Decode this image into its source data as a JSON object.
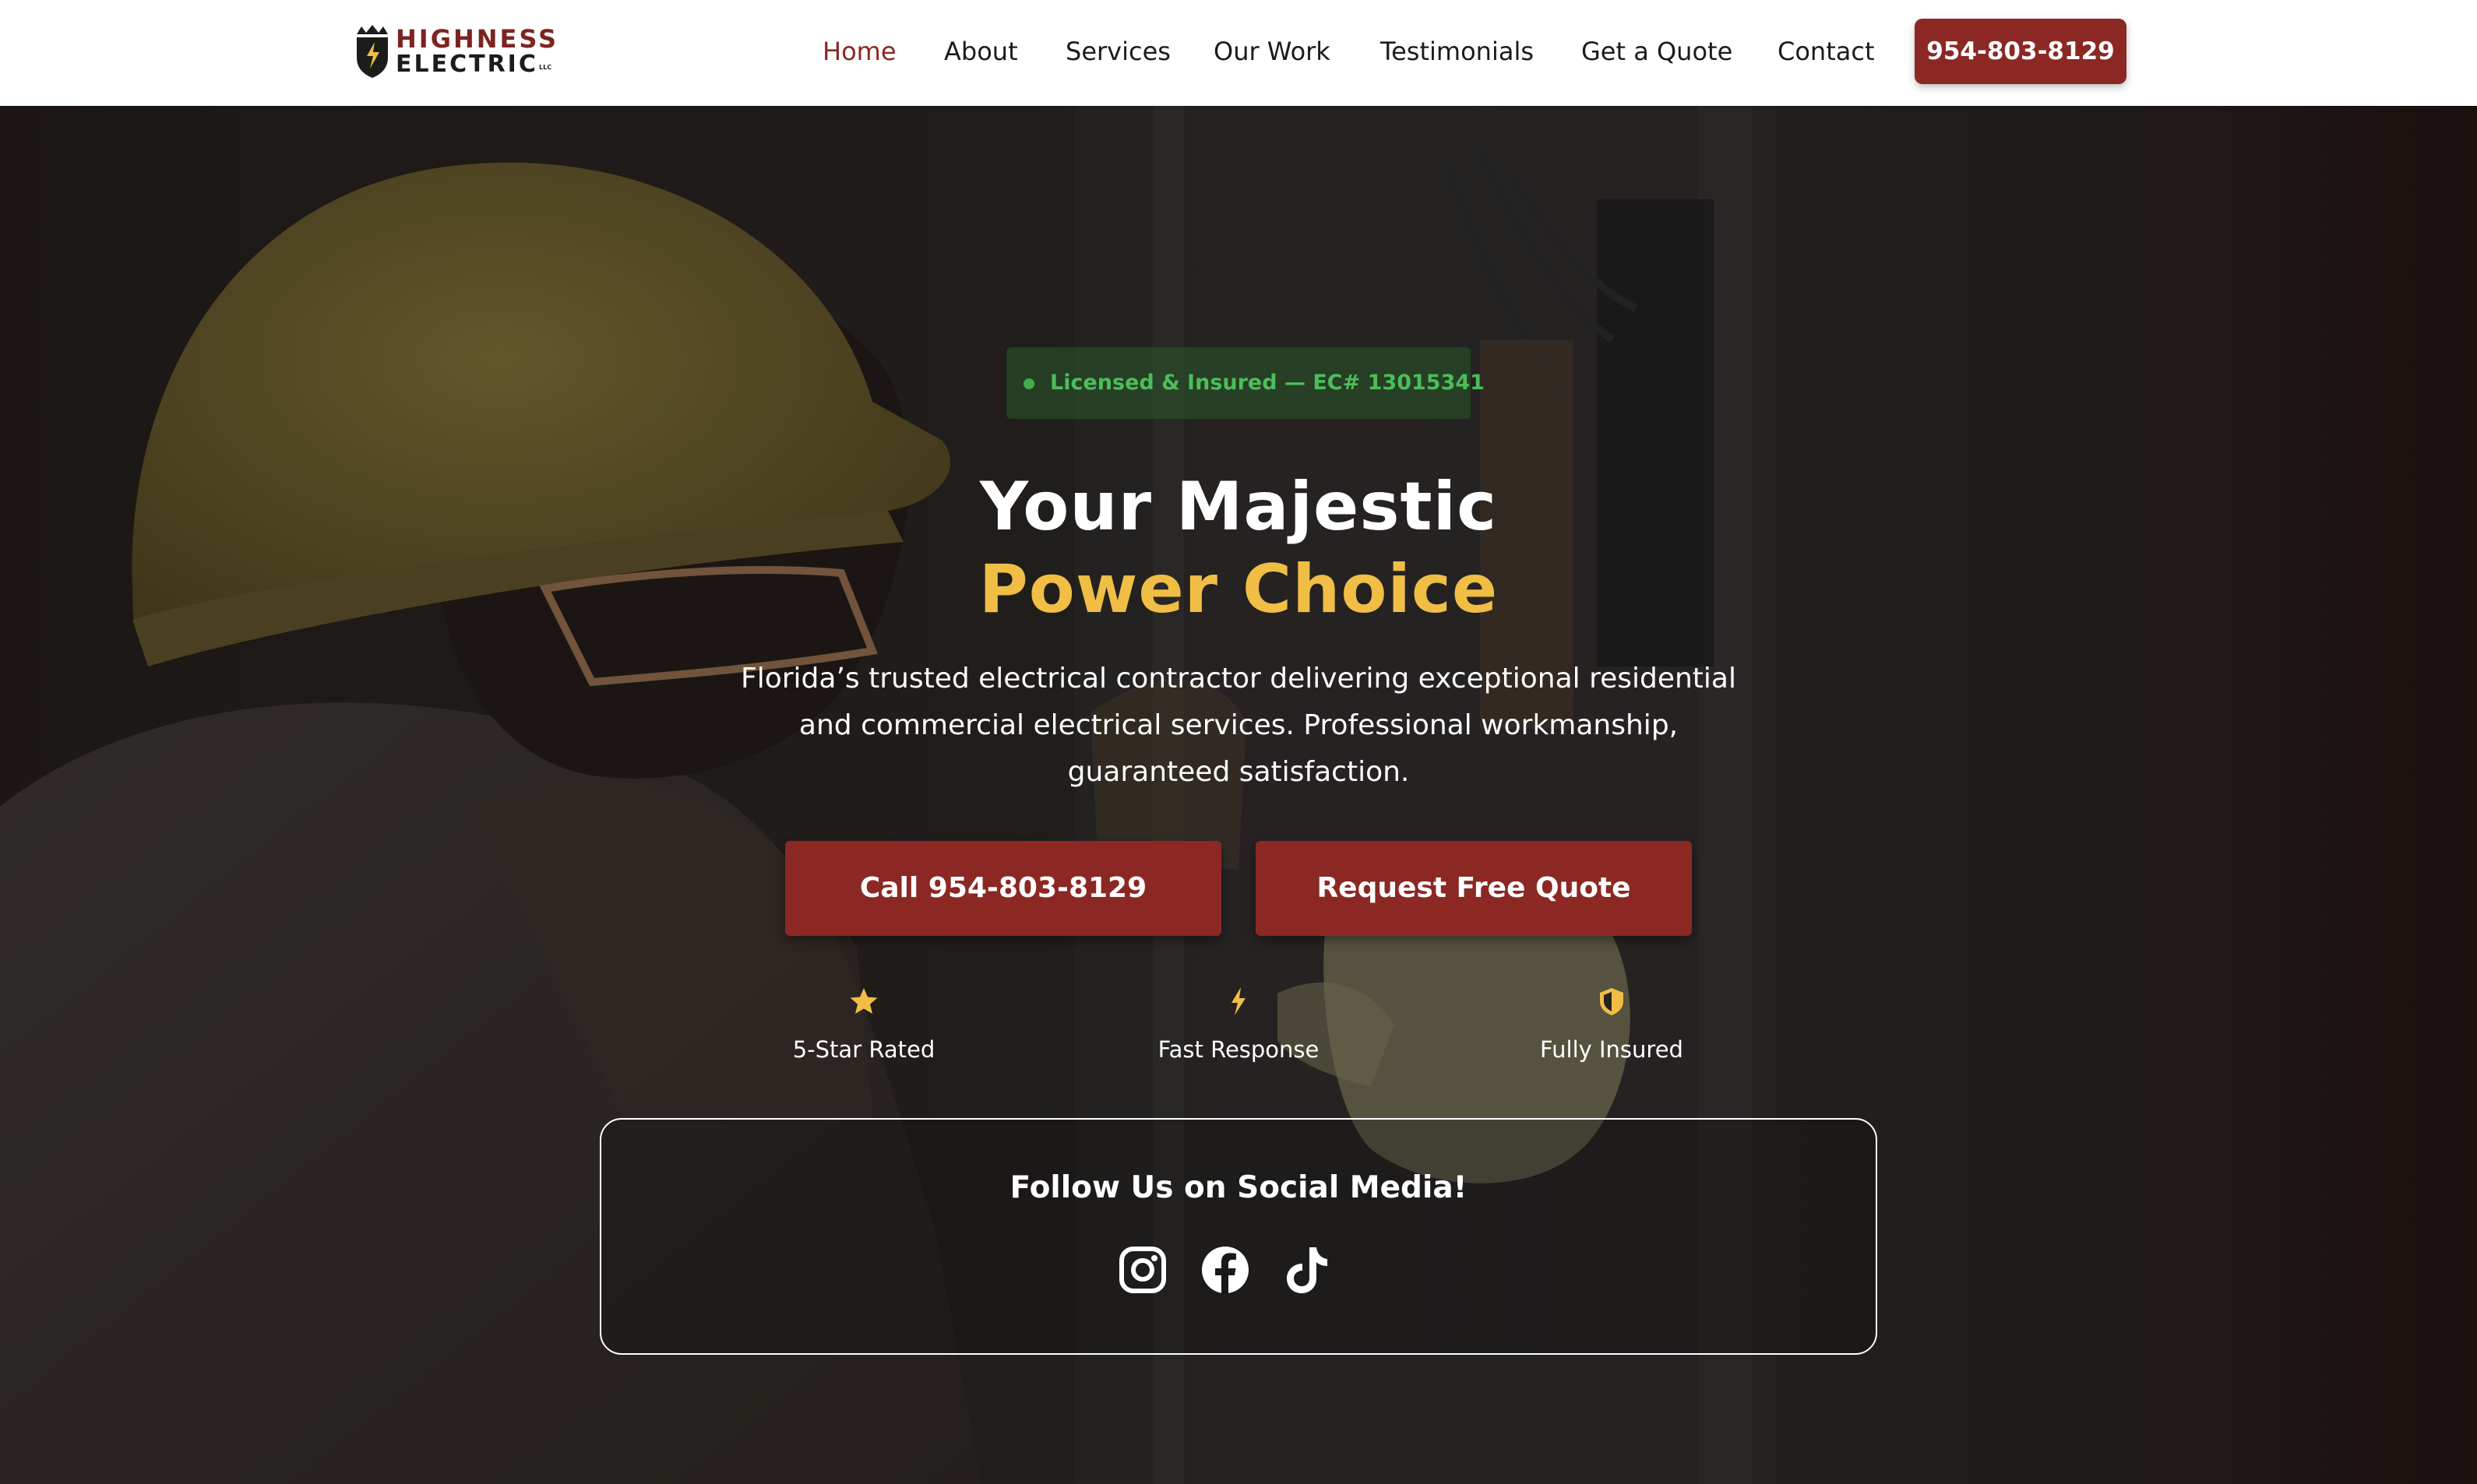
{
  "header": {
    "logo": {
      "line1": "HIGHNESS",
      "line2": "ELECTRIC",
      "suffix": "LLC"
    },
    "nav": [
      {
        "label": "Home",
        "active": true
      },
      {
        "label": "About"
      },
      {
        "label": "Services"
      },
      {
        "label": "Our Work"
      },
      {
        "label": "Testimonials"
      },
      {
        "label": "Get a Quote"
      },
      {
        "label": "Contact"
      }
    ],
    "phone_button": "954-803-8129"
  },
  "hero": {
    "badge": "Licensed & Insured — EC# 13015341",
    "title_line1": "Your Majestic",
    "title_line2": "Power Choice",
    "subtitle": "Florida’s trusted electrical contractor delivering exceptional residential and commercial electrical services. Professional workmanship, guaranteed satisfaction.",
    "cta_call": "Call 954-803-8129",
    "cta_quote": "Request Free Quote",
    "features": [
      {
        "icon": "star-icon",
        "label": "5-Star Rated"
      },
      {
        "icon": "lightning-bolt-icon",
        "label": "Fast Response"
      },
      {
        "icon": "shield-icon",
        "label": "Fully Insured"
      }
    ],
    "social": {
      "title": "Follow Us on Social Media!",
      "icons": [
        "instagram-icon",
        "facebook-icon",
        "tiktok-icon"
      ]
    }
  },
  "colors": {
    "brand_red": "#8b2824",
    "accent_gold": "#f0be45",
    "badge_green": "#4cbd5b",
    "header_bg": "#ffffff"
  }
}
